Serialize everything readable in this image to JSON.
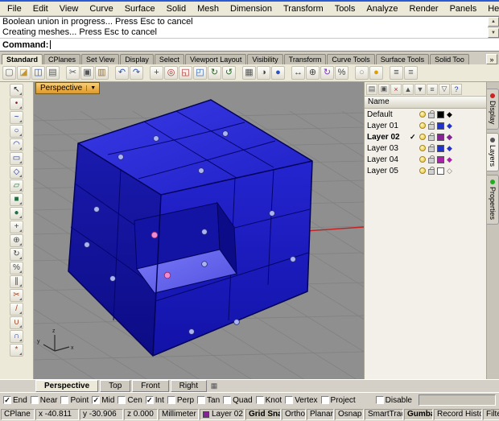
{
  "window": {
    "menu_items": [
      "File",
      "Edit",
      "View",
      "Curve",
      "Surface",
      "Solid",
      "Mesh",
      "Dimension",
      "Transform",
      "Tools",
      "Analyze",
      "Render",
      "Panels",
      "Help"
    ]
  },
  "command_area": {
    "history_lines": [
      "Boolean union in progress... Press Esc to cancel",
      "Creating meshes... Press Esc to cancel"
    ],
    "prompt": "Command:",
    "scroll_up_glyph": "▲",
    "scroll_down_glyph": "▼"
  },
  "toolbar": {
    "tabs": [
      {
        "label": "Standard",
        "name": "tab-standard",
        "active": true
      },
      {
        "label": "CPlanes",
        "name": "tab-cplanes",
        "active": false
      },
      {
        "label": "Set View",
        "name": "tab-set-view",
        "active": false
      },
      {
        "label": "Display",
        "name": "tab-display",
        "active": false
      },
      {
        "label": "Select",
        "name": "tab-select",
        "active": false
      },
      {
        "label": "Viewport Layout",
        "name": "tab-viewport-layout",
        "active": false
      },
      {
        "label": "Visibility",
        "name": "tab-visibility",
        "active": false
      },
      {
        "label": "Transform",
        "name": "tab-transform",
        "active": false
      },
      {
        "label": "Curve Tools",
        "name": "tab-curve-tools",
        "active": false
      },
      {
        "label": "Surface Tools",
        "name": "tab-surface-tools",
        "active": false
      },
      {
        "label": "Solid Too",
        "name": "tab-solid-tools",
        "active": false
      }
    ],
    "overflow_glyph": "»",
    "icons": [
      {
        "name": "new-file-button",
        "icon": "new-file-icon",
        "glyph": "▢",
        "color": "#666666"
      },
      {
        "name": "open-file-button",
        "icon": "open-folder-icon",
        "glyph": "◪",
        "color": "#c8962e"
      },
      {
        "name": "save-button",
        "icon": "save-icon",
        "glyph": "◫",
        "color": "#2a52be"
      },
      {
        "name": "print-button",
        "icon": "print-icon",
        "glyph": "▤",
        "color": "#555555"
      },
      {
        "name": "cut-button",
        "icon": "scissors-icon",
        "glyph": "✂",
        "color": "#555555"
      },
      {
        "name": "copy-button",
        "icon": "copy-icon",
        "glyph": "▣",
        "color": "#555555"
      },
      {
        "name": "paste-button",
        "icon": "paste-icon",
        "glyph": "▥",
        "color": "#8a6d3b"
      },
      {
        "name": "undo-button",
        "icon": "undo-icon",
        "glyph": "↶",
        "color": "#2a52be"
      },
      {
        "name": "redo-button",
        "icon": "redo-icon",
        "glyph": "↷",
        "color": "#2a52be"
      },
      {
        "name": "pan-button",
        "icon": "pan-icon",
        "glyph": "+",
        "color": "#444444"
      },
      {
        "name": "zoom-dynamic-button",
        "icon": "zoom-icon",
        "glyph": "◎",
        "color": "#b03030"
      },
      {
        "name": "zoom-window-button",
        "icon": "zoom-window-icon",
        "glyph": "◱",
        "color": "#b03030"
      },
      {
        "name": "zoom-extents-button",
        "icon": "zoom-extents-icon",
        "glyph": "◰",
        "color": "#3060b0"
      },
      {
        "name": "rotate-view-button",
        "icon": "rotate-view-icon",
        "glyph": "↻",
        "color": "#207020"
      },
      {
        "name": "undo-view-button",
        "icon": "undo-view-icon",
        "glyph": "↺",
        "color": "#207020"
      },
      {
        "name": "named-views-button",
        "icon": "named-views-icon",
        "glyph": "▦",
        "color": "#555555"
      },
      {
        "name": "shaded-display-button",
        "icon": "shaded-display-icon",
        "glyph": "◑",
        "color": "#444444"
      },
      {
        "name": "render-button",
        "icon": "render-icon",
        "glyph": "●",
        "color": "#3050c0"
      },
      {
        "name": "move-button",
        "icon": "move-icon",
        "glyph": "↔",
        "color": "#444444"
      },
      {
        "name": "copy-object-button",
        "icon": "duplicate-icon",
        "glyph": "⊕",
        "color": "#444444"
      },
      {
        "name": "rotate-button",
        "icon": "rotate-icon",
        "glyph": "↻",
        "color": "#8a2be2"
      },
      {
        "name": "scale-button",
        "icon": "scale-icon",
        "glyph": "%",
        "color": "#444444"
      },
      {
        "name": "hide-button",
        "icon": "hide-icon",
        "glyph": "○",
        "color": "#888888"
      },
      {
        "name": "show-button",
        "icon": "show-icon",
        "glyph": "●",
        "color": "#d8a000"
      },
      {
        "name": "layers-dialog-button",
        "icon": "layers-icon",
        "glyph": "≡",
        "color": "#444444"
      },
      {
        "name": "properties-dialog-button",
        "icon": "properties-icon",
        "glyph": "≡",
        "color": "#207070"
      }
    ]
  },
  "left_toolbar": {
    "tools": [
      {
        "name": "select-tool-button",
        "icon": "cursor-icon",
        "glyph": "↖",
        "color": "#222222"
      },
      {
        "name": "point-tool-button",
        "icon": "point-icon",
        "glyph": "•",
        "color": "#802020"
      },
      {
        "name": "curve-tool-button",
        "icon": "curve-icon",
        "glyph": "~",
        "color": "#203080"
      },
      {
        "name": "circle-tool-button",
        "icon": "circle-icon",
        "glyph": "○",
        "color": "#203080"
      },
      {
        "name": "arc-tool-button",
        "icon": "arc-icon",
        "glyph": "◠",
        "color": "#203080"
      },
      {
        "name": "rectangle-tool-button",
        "icon": "rectangle-icon",
        "glyph": "▭",
        "color": "#203080"
      },
      {
        "name": "polygon-tool-button",
        "icon": "polygon-icon",
        "glyph": "◇",
        "color": "#203080"
      },
      {
        "name": "surface-tool-button",
        "icon": "surface-icon",
        "glyph": "▱",
        "color": "#207040"
      },
      {
        "name": "box-tool-button",
        "icon": "box-icon",
        "glyph": "■",
        "color": "#207040"
      },
      {
        "name": "sphere-tool-button",
        "icon": "sphere-icon",
        "glyph": "●",
        "color": "#207040"
      },
      {
        "name": "move-tool-button",
        "icon": "move-icon",
        "glyph": "+",
        "color": "#444444"
      },
      {
        "name": "copy-tool-button",
        "icon": "copy-icon",
        "glyph": "⊕",
        "color": "#444444"
      },
      {
        "name": "rotate-tool-button",
        "icon": "rotate-icon",
        "glyph": "↻",
        "color": "#444444"
      },
      {
        "name": "scale-tool-button",
        "icon": "scale-icon",
        "glyph": "%",
        "color": "#444444"
      },
      {
        "name": "mirror-tool-button",
        "icon": "mirror-icon",
        "glyph": "∥",
        "color": "#444444"
      },
      {
        "name": "trim-tool-button",
        "icon": "trim-icon",
        "glyph": "✂",
        "color": "#a04020"
      },
      {
        "name": "split-tool-button",
        "icon": "split-icon",
        "glyph": "/",
        "color": "#a04020"
      },
      {
        "name": "join-tool-button",
        "icon": "join-icon",
        "glyph": "∪",
        "color": "#a04020"
      },
      {
        "name": "boolean-union-tool-button",
        "icon": "boolean-union-icon",
        "glyph": "∩",
        "color": "#3040a0"
      },
      {
        "name": "explode-tool-button",
        "icon": "explode-icon",
        "glyph": "*",
        "color": "#a04020"
      }
    ]
  },
  "viewport": {
    "label": "Perspective",
    "dropdown_glyph": "▼",
    "object_color": "#1a1ac2",
    "axis_labels": {
      "x": "x",
      "y": "y",
      "z": "z"
    }
  },
  "viewport_tabs": {
    "tabs": [
      {
        "label": "Perspective",
        "name": "tab-viewport-perspective",
        "active": true
      },
      {
        "label": "Top",
        "name": "tab-viewport-top",
        "active": false
      },
      {
        "label": "Front",
        "name": "tab-viewport-front",
        "active": false
      },
      {
        "label": "Right",
        "name": "tab-viewport-right",
        "active": false
      }
    ],
    "more_glyph": "▦"
  },
  "layers_panel": {
    "header_icons": [
      {
        "name": "new-layer-button",
        "icon": "new-layer-icon",
        "glyph": "▤",
        "color": "#555555"
      },
      {
        "name": "new-sublayer-button",
        "icon": "new-sublayer-icon",
        "glyph": "▣",
        "color": "#555555"
      },
      {
        "name": "delete-layer-button",
        "icon": "delete-icon",
        "glyph": "×",
        "color": "#b03030"
      },
      {
        "name": "move-up-button",
        "icon": "arrow-up-icon",
        "glyph": "▲",
        "color": "#555555"
      },
      {
        "name": "move-down-button",
        "icon": "arrow-down-icon",
        "glyph": "▼",
        "color": "#555555"
      },
      {
        "name": "layer-tools-button",
        "icon": "menu-icon",
        "glyph": "≡",
        "color": "#555555"
      },
      {
        "name": "filter-button",
        "icon": "filter-icon",
        "glyph": "▽",
        "color": "#555555"
      },
      {
        "name": "help-button",
        "icon": "help-icon",
        "glyph": "?",
        "color": "#2040a0"
      }
    ],
    "name_header": "Name",
    "rows": [
      {
        "name": "Default",
        "check": "",
        "current": false,
        "color": "#000000",
        "material": "◆",
        "material_color": "#000000"
      },
      {
        "name": "Layer 01",
        "check": "",
        "current": false,
        "color": "#2233cc",
        "material": "◆",
        "material_color": "#2233cc"
      },
      {
        "name": "Layer 02",
        "check": "✓",
        "current": true,
        "color": "#882299",
        "material": "◆",
        "material_color": "#882299"
      },
      {
        "name": "Layer 03",
        "check": "",
        "current": false,
        "color": "#2233cc",
        "material": "◆",
        "material_color": "#2233cc"
      },
      {
        "name": "Layer 04",
        "check": "",
        "current": false,
        "color": "#aa22aa",
        "material": "◆",
        "material_color": "#aa22aa"
      },
      {
        "name": "Layer 05",
        "check": "",
        "current": false,
        "color": "#ffffff",
        "material": "◇",
        "material_color": "#777777"
      }
    ]
  },
  "side_tabs": [
    {
      "label": "Display",
      "name": "panel-tab-display",
      "dot": "#cc2222",
      "active": false
    },
    {
      "label": "Layers",
      "name": "panel-tab-layers",
      "dot": "#555555",
      "active": true
    },
    {
      "label": "Properties",
      "name": "panel-tab-properties",
      "dot": "#22aa22",
      "active": false
    }
  ],
  "osnap": {
    "items": [
      {
        "label": "End",
        "name": "osnap-end",
        "check": "✓"
      },
      {
        "label": "Near",
        "name": "osnap-near",
        "check": ""
      },
      {
        "label": "Point",
        "name": "osnap-point",
        "check": ""
      },
      {
        "label": "Mid",
        "name": "osnap-mid",
        "check": "✓"
      },
      {
        "label": "Cen",
        "name": "osnap-cen",
        "check": ""
      },
      {
        "label": "Int",
        "name": "osnap-int",
        "check": "✓"
      },
      {
        "label": "Perp",
        "name": "osnap-perp",
        "check": ""
      },
      {
        "label": "Tan",
        "name": "osnap-tan",
        "check": ""
      },
      {
        "label": "Quad",
        "name": "osnap-quad",
        "check": ""
      },
      {
        "label": "Knot",
        "name": "osnap-knot",
        "check": ""
      },
      {
        "label": "Vertex",
        "name": "osnap-vertex",
        "check": ""
      },
      {
        "label": "Project",
        "name": "osnap-project",
        "check": ""
      }
    ],
    "disable_label": "Disable",
    "disable_check": ""
  },
  "status_bar": {
    "cplane": "CPlane",
    "coords": {
      "x": "x -40.811",
      "y": "y -30.906",
      "z": "z 0.000"
    },
    "units": "Millimeter",
    "layer": {
      "label": "Layer 02",
      "color": "#882299"
    },
    "panes": [
      {
        "label": "Grid Sna",
        "name": "pane-grid-snap",
        "active": true
      },
      {
        "label": "Ortho",
        "name": "pane-ortho",
        "active": false
      },
      {
        "label": "Planar",
        "name": "pane-planar",
        "active": false
      },
      {
        "label": "Osnap",
        "name": "pane-osnap",
        "active": false
      },
      {
        "label": "SmartTrack",
        "name": "pane-smarttrack",
        "active": false
      },
      {
        "label": "Gumbal",
        "name": "pane-gumball",
        "active": true
      },
      {
        "label": "Record Histor",
        "name": "pane-record-history",
        "active": false
      },
      {
        "label": "Filter",
        "name": "pane-filter",
        "active": false
      }
    ]
  }
}
